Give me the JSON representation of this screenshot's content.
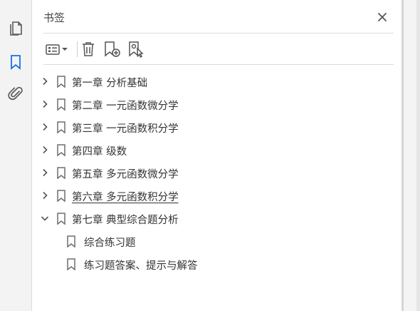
{
  "panel": {
    "title": "书签"
  },
  "bookmarks": [
    {
      "label": "第一章  分析基础",
      "expanded": false
    },
    {
      "label": "第二章  一元函数微分学",
      "expanded": false
    },
    {
      "label": "第三章  一元函数积分学",
      "expanded": false
    },
    {
      "label": "第四章  级数",
      "expanded": false
    },
    {
      "label": "第五章  多元函数微分学",
      "expanded": false
    },
    {
      "label": "第六章  多元函数积分学",
      "expanded": false,
      "hovered": true
    },
    {
      "label": "第七章  典型综合题分析",
      "expanded": true,
      "children": [
        {
          "label": "综合练习题"
        },
        {
          "label": "练习题答案、提示与解答"
        }
      ]
    }
  ],
  "colors": {
    "active_icon": "#1473e6",
    "icon_gray": "#6e6e6e"
  }
}
